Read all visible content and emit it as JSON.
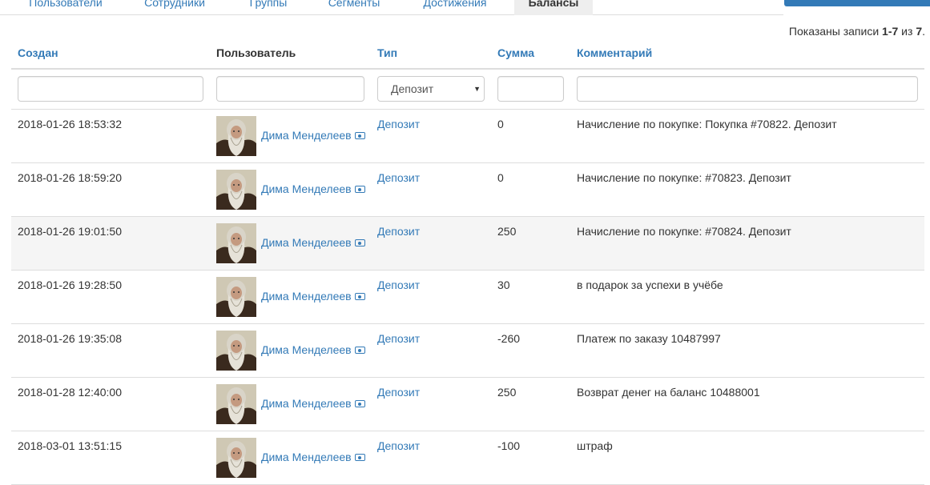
{
  "tabs": [
    {
      "label": "Пользователи"
    },
    {
      "label": "Сотрудники"
    },
    {
      "label": "Группы"
    },
    {
      "label": "Сегменты"
    },
    {
      "label": "Достижения"
    },
    {
      "label": "Балансы"
    }
  ],
  "active_tab": "Балансы",
  "summary": {
    "prefix": "Показаны записи ",
    "range": "1-7",
    "of": " из ",
    "total": "7",
    "suffix": "."
  },
  "table": {
    "columns": [
      "Создан",
      "Пользователь",
      "Тип",
      "Сумма",
      "Комментарий"
    ],
    "filters": {
      "type_selected": "Депозит"
    },
    "rows": [
      {
        "created": "2018-01-26 18:53:32",
        "user": "Дима Менделеев",
        "type": "Депозит",
        "amount": "0",
        "comment": "Начисление по покупке: Покупка #70822. Депозит"
      },
      {
        "created": "2018-01-26 18:59:20",
        "user": "Дима Менделеев",
        "type": "Депозит",
        "amount": "0",
        "comment": "Начисление по покупке: #70823. Депозит"
      },
      {
        "created": "2018-01-26 19:01:50",
        "user": "Дима Менделеев",
        "type": "Депозит",
        "amount": "250",
        "comment": "Начисление по покупке: #70824. Депозит"
      },
      {
        "created": "2018-01-26 19:28:50",
        "user": "Дима Менделеев",
        "type": "Депозит",
        "amount": "30",
        "comment": "в подарок за успехи в учёбе"
      },
      {
        "created": "2018-01-26 19:35:08",
        "user": "Дима Менделеев",
        "type": "Депозит",
        "amount": "-260",
        "comment": "Платеж по заказу 10487997"
      },
      {
        "created": "2018-01-28 12:40:00",
        "user": "Дима Менделеев",
        "type": "Депозит",
        "amount": "250",
        "comment": "Возврат денег на баланс 10488001"
      },
      {
        "created": "2018-03-01 13:51:15",
        "user": "Дима Менделеев",
        "type": "Депозит",
        "amount": "-100",
        "comment": "штраф"
      }
    ]
  },
  "colors": {
    "link": "#337ab7",
    "stripe": "#f5f5f5",
    "border": "#dddddd",
    "tab_active_bg": "#eeeeee"
  },
  "icons": {
    "user_avatar": "avatar-photo",
    "view_profile": "eye-icon"
  }
}
